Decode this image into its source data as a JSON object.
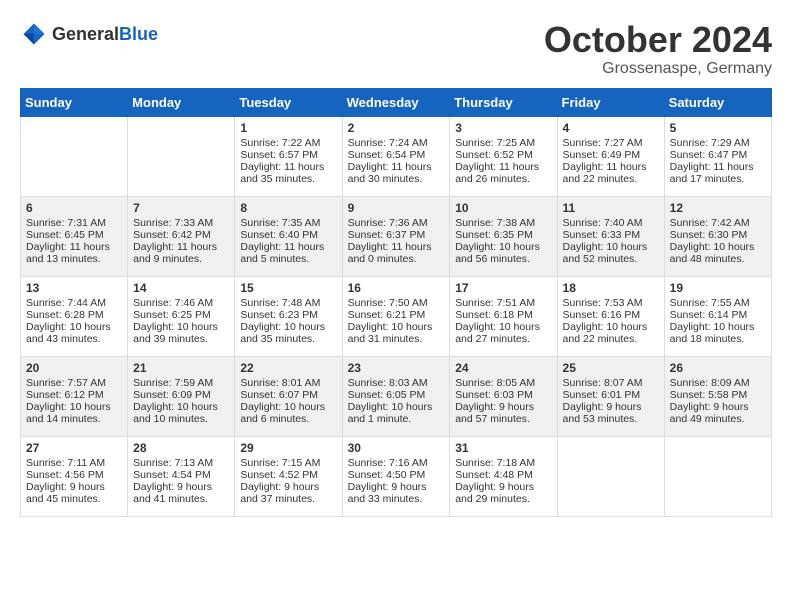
{
  "header": {
    "logo_general": "General",
    "logo_blue": "Blue",
    "month_title": "October 2024",
    "location": "Grossenaspe, Germany"
  },
  "calendar": {
    "days_of_week": [
      "Sunday",
      "Monday",
      "Tuesday",
      "Wednesday",
      "Thursday",
      "Friday",
      "Saturday"
    ],
    "weeks": [
      {
        "shaded": false,
        "days": [
          {
            "num": "",
            "content": ""
          },
          {
            "num": "",
            "content": ""
          },
          {
            "num": "1",
            "content": "Sunrise: 7:22 AM\nSunset: 6:57 PM\nDaylight: 11 hours and 35 minutes."
          },
          {
            "num": "2",
            "content": "Sunrise: 7:24 AM\nSunset: 6:54 PM\nDaylight: 11 hours and 30 minutes."
          },
          {
            "num": "3",
            "content": "Sunrise: 7:25 AM\nSunset: 6:52 PM\nDaylight: 11 hours and 26 minutes."
          },
          {
            "num": "4",
            "content": "Sunrise: 7:27 AM\nSunset: 6:49 PM\nDaylight: 11 hours and 22 minutes."
          },
          {
            "num": "5",
            "content": "Sunrise: 7:29 AM\nSunset: 6:47 PM\nDaylight: 11 hours and 17 minutes."
          }
        ]
      },
      {
        "shaded": true,
        "days": [
          {
            "num": "6",
            "content": "Sunrise: 7:31 AM\nSunset: 6:45 PM\nDaylight: 11 hours and 13 minutes."
          },
          {
            "num": "7",
            "content": "Sunrise: 7:33 AM\nSunset: 6:42 PM\nDaylight: 11 hours and 9 minutes."
          },
          {
            "num": "8",
            "content": "Sunrise: 7:35 AM\nSunset: 6:40 PM\nDaylight: 11 hours and 5 minutes."
          },
          {
            "num": "9",
            "content": "Sunrise: 7:36 AM\nSunset: 6:37 PM\nDaylight: 11 hours and 0 minutes."
          },
          {
            "num": "10",
            "content": "Sunrise: 7:38 AM\nSunset: 6:35 PM\nDaylight: 10 hours and 56 minutes."
          },
          {
            "num": "11",
            "content": "Sunrise: 7:40 AM\nSunset: 6:33 PM\nDaylight: 10 hours and 52 minutes."
          },
          {
            "num": "12",
            "content": "Sunrise: 7:42 AM\nSunset: 6:30 PM\nDaylight: 10 hours and 48 minutes."
          }
        ]
      },
      {
        "shaded": false,
        "days": [
          {
            "num": "13",
            "content": "Sunrise: 7:44 AM\nSunset: 6:28 PM\nDaylight: 10 hours and 43 minutes."
          },
          {
            "num": "14",
            "content": "Sunrise: 7:46 AM\nSunset: 6:25 PM\nDaylight: 10 hours and 39 minutes."
          },
          {
            "num": "15",
            "content": "Sunrise: 7:48 AM\nSunset: 6:23 PM\nDaylight: 10 hours and 35 minutes."
          },
          {
            "num": "16",
            "content": "Sunrise: 7:50 AM\nSunset: 6:21 PM\nDaylight: 10 hours and 31 minutes."
          },
          {
            "num": "17",
            "content": "Sunrise: 7:51 AM\nSunset: 6:18 PM\nDaylight: 10 hours and 27 minutes."
          },
          {
            "num": "18",
            "content": "Sunrise: 7:53 AM\nSunset: 6:16 PM\nDaylight: 10 hours and 22 minutes."
          },
          {
            "num": "19",
            "content": "Sunrise: 7:55 AM\nSunset: 6:14 PM\nDaylight: 10 hours and 18 minutes."
          }
        ]
      },
      {
        "shaded": true,
        "days": [
          {
            "num": "20",
            "content": "Sunrise: 7:57 AM\nSunset: 6:12 PM\nDaylight: 10 hours and 14 minutes."
          },
          {
            "num": "21",
            "content": "Sunrise: 7:59 AM\nSunset: 6:09 PM\nDaylight: 10 hours and 10 minutes."
          },
          {
            "num": "22",
            "content": "Sunrise: 8:01 AM\nSunset: 6:07 PM\nDaylight: 10 hours and 6 minutes."
          },
          {
            "num": "23",
            "content": "Sunrise: 8:03 AM\nSunset: 6:05 PM\nDaylight: 10 hours and 1 minute."
          },
          {
            "num": "24",
            "content": "Sunrise: 8:05 AM\nSunset: 6:03 PM\nDaylight: 9 hours and 57 minutes."
          },
          {
            "num": "25",
            "content": "Sunrise: 8:07 AM\nSunset: 6:01 PM\nDaylight: 9 hours and 53 minutes."
          },
          {
            "num": "26",
            "content": "Sunrise: 8:09 AM\nSunset: 5:58 PM\nDaylight: 9 hours and 49 minutes."
          }
        ]
      },
      {
        "shaded": false,
        "days": [
          {
            "num": "27",
            "content": "Sunrise: 7:11 AM\nSunset: 4:56 PM\nDaylight: 9 hours and 45 minutes."
          },
          {
            "num": "28",
            "content": "Sunrise: 7:13 AM\nSunset: 4:54 PM\nDaylight: 9 hours and 41 minutes."
          },
          {
            "num": "29",
            "content": "Sunrise: 7:15 AM\nSunset: 4:52 PM\nDaylight: 9 hours and 37 minutes."
          },
          {
            "num": "30",
            "content": "Sunrise: 7:16 AM\nSunset: 4:50 PM\nDaylight: 9 hours and 33 minutes."
          },
          {
            "num": "31",
            "content": "Sunrise: 7:18 AM\nSunset: 4:48 PM\nDaylight: 9 hours and 29 minutes."
          },
          {
            "num": "",
            "content": ""
          },
          {
            "num": "",
            "content": ""
          }
        ]
      }
    ]
  }
}
